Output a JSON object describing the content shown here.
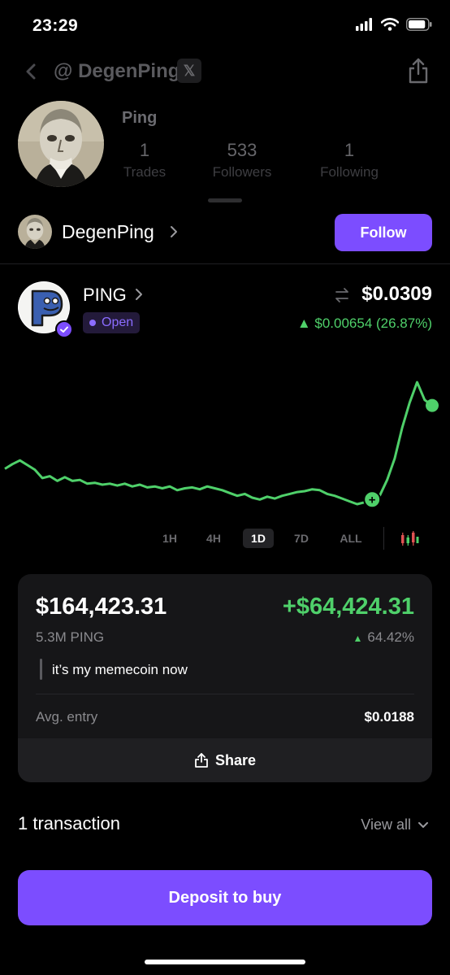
{
  "status_bar": {
    "time": "23:29",
    "battery_level": 0.9
  },
  "header": {
    "handle": "@ DegenPing",
    "x_badge": "𝕏"
  },
  "profile": {
    "name": "Ping",
    "stats": [
      {
        "value": "1",
        "label": "Trades"
      },
      {
        "value": "533",
        "label": "Followers"
      },
      {
        "value": "1",
        "label": "Following"
      }
    ]
  },
  "user_row": {
    "username": "DegenPing",
    "follow_label": "Follow"
  },
  "token": {
    "symbol": "PING",
    "status": "Open",
    "price": "$0.0309",
    "change": "▲ $0.00654 (26.87%)"
  },
  "chart_data": {
    "type": "line",
    "series": [
      {
        "values": [
          0.0241,
          0.0246,
          0.025,
          0.0245,
          0.024,
          0.0231,
          0.0233,
          0.0228,
          0.0232,
          0.0228,
          0.0229,
          0.0225,
          0.0226,
          0.0224,
          0.0225,
          0.0223,
          0.0225,
          0.0222,
          0.0224,
          0.0221,
          0.0222,
          0.022,
          0.0222,
          0.0218,
          0.022,
          0.0221,
          0.0219,
          0.0222,
          0.022,
          0.0218,
          0.0215,
          0.0212,
          0.0214,
          0.021,
          0.0208,
          0.0211,
          0.0209,
          0.0212,
          0.0214,
          0.0216,
          0.0217,
          0.0219,
          0.0218,
          0.0214,
          0.0212,
          0.0209,
          0.0206,
          0.0203,
          0.0205,
          0.0208,
          0.0212,
          0.0229,
          0.0252,
          0.0285,
          0.0312,
          0.0334,
          0.0315,
          0.0309
        ],
        "color": "#4fd06a"
      }
    ],
    "markers": [
      {
        "type": "buy",
        "label": "+",
        "index": 49
      }
    ],
    "grid": false,
    "legend": false
  },
  "time_ranges": [
    {
      "label": "1H",
      "active": false
    },
    {
      "label": "4H",
      "active": false
    },
    {
      "label": "1D",
      "active": true
    },
    {
      "label": "7D",
      "active": false
    },
    {
      "label": "ALL",
      "active": false
    }
  ],
  "position": {
    "value": "$164,423.31",
    "pnl": "+$64,424.31",
    "quantity": "5.3M PING",
    "pnl_pct": "64.42%",
    "note": "it’s my memecoin now",
    "avg_entry_label": "Avg. entry",
    "avg_entry_value": "$0.0188",
    "share_label": "Share"
  },
  "transactions": {
    "title": "1 transaction",
    "view_all": "View all"
  },
  "deposit_label": "Deposit to buy",
  "colors": {
    "accent": "#7c4dff",
    "positive": "#4fd06a",
    "background": "#000000",
    "card": "#161618"
  }
}
